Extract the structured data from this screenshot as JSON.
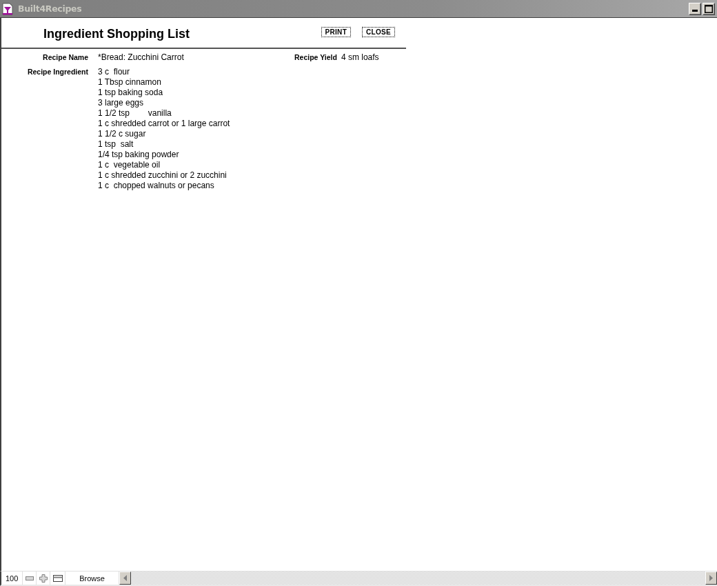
{
  "window": {
    "title": "Built4Recipes"
  },
  "header": {
    "title": "Ingredient Shopping List",
    "buttons": [
      "PRINT",
      "CLOSE"
    ]
  },
  "fields": {
    "recipe_name": {
      "label": "Recipe Name",
      "value": "*Bread: Zucchini Carrot"
    },
    "recipe_yield": {
      "label": "Recipe Yield",
      "value": "4 sm loafs"
    },
    "recipe_ingredient": {
      "label": "Recipe Ingredient",
      "lines": [
        "3 c  flour",
        "1 Tbsp cinnamon",
        "1 tsp baking soda",
        "3 large eggs",
        "1 1/2 tsp        vanilla",
        "1 c shredded carrot or 1 large carrot",
        "1 1/2 c sugar",
        "1 tsp  salt",
        "1/4 tsp baking powder",
        "1 c  vegetable oil",
        "1 c shredded zucchini or 2 zucchini",
        "1 c  chopped walnuts or pecans"
      ]
    }
  },
  "status_bar": {
    "zoom": "100",
    "mode": "Browse"
  }
}
